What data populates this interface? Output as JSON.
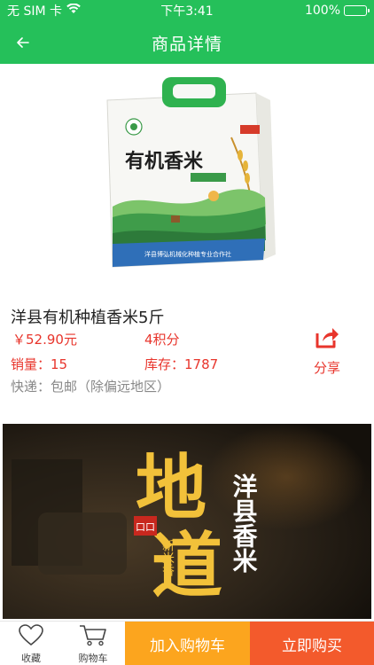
{
  "status_bar": {
    "carrier": "无 SIM 卡",
    "time": "下午3:41",
    "battery_percent": "100%",
    "battery_level": 1.0
  },
  "nav": {
    "title": "商品详情",
    "back_icon": "back-arrow-icon"
  },
  "product": {
    "package_brand": "有机香米",
    "package_label": "洋县博弘机械化种植专业合作社",
    "title": "洋县有机种植香米5斤",
    "price": "￥52.90元",
    "points": "4积分",
    "sales": "销量：15",
    "stock": "库存：1787",
    "shipping": "快递：包邮（除偏远地区）",
    "share_label": "分享",
    "share_icon": "share-icon"
  },
  "banner": {
    "big_text_1": "地",
    "big_text_2": "道",
    "vertical_text": "洋县香米",
    "stamp_text": "口口",
    "small_vertical": "新米香"
  },
  "bottom_bar": {
    "favorite_label": "收藏",
    "favorite_icon": "heart-icon",
    "cart_label": "购物车",
    "cart_icon": "cart-icon",
    "add_cart_label": "加入购物车",
    "buy_now_label": "立即购买"
  },
  "colors": {
    "brand_green": "#25c05a",
    "price_red": "#e8352c",
    "add_cart_orange": "#fca51e",
    "buy_now_red": "#f35a2c"
  }
}
